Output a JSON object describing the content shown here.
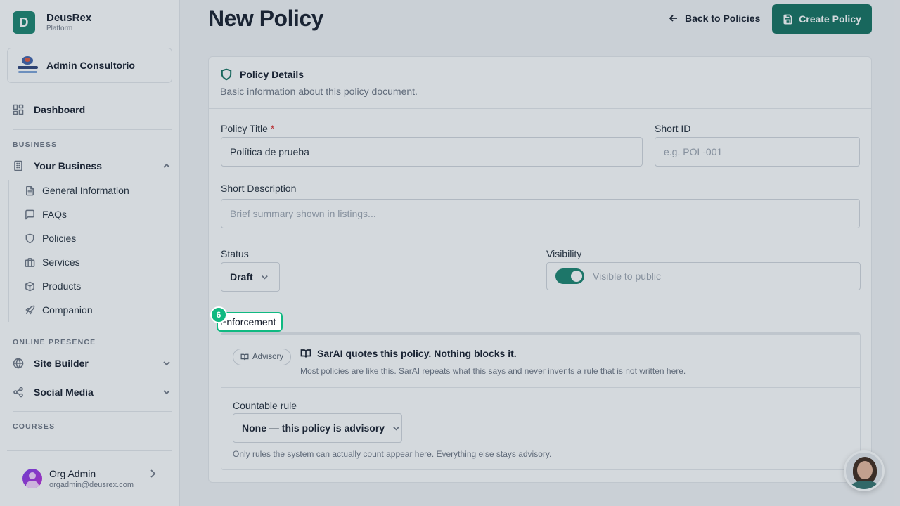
{
  "brand": {
    "logo_letter": "D",
    "name": "DeusRex",
    "subtitle": "Platform"
  },
  "org": {
    "name": "Admin Consultorio",
    "logo_icon": "org-logo"
  },
  "sidebar": {
    "dashboard": {
      "label": "Dashboard",
      "icon": "dashboard-grid-icon"
    },
    "business_label": "BUSINESS",
    "your_business": {
      "label": "Your Business",
      "icon": "building-icon",
      "expanded": true
    },
    "business_items": [
      {
        "label": "General Information",
        "icon": "file-text-icon"
      },
      {
        "label": "FAQs",
        "icon": "message-square-icon"
      },
      {
        "label": "Policies",
        "icon": "shield-icon"
      },
      {
        "label": "Services",
        "icon": "briefcase-icon"
      },
      {
        "label": "Products",
        "icon": "package-icon"
      },
      {
        "label": "Companion",
        "icon": "rocket-icon"
      }
    ],
    "online_presence_label": "ONLINE PRESENCE",
    "site_builder": {
      "label": "Site Builder",
      "icon": "globe-icon"
    },
    "social_media": {
      "label": "Social Media",
      "icon": "share-icon"
    },
    "courses_label": "COURSES",
    "user": {
      "name": "Org Admin",
      "email": "orgadmin@deusrex.com"
    }
  },
  "header": {
    "title": "New Policy",
    "back_label": "Back to Policies",
    "create_label": "Create Policy"
  },
  "policy_details": {
    "heading": "Policy Details",
    "description": "Basic information about this policy document.",
    "title_label": "Policy Title",
    "title_required": "*",
    "title_value": "Política de prueba",
    "short_id_label": "Short ID",
    "short_id_placeholder": "e.g. POL-001",
    "short_desc_label": "Short Description",
    "short_desc_placeholder": "Brief summary shown in listings...",
    "status_label": "Status",
    "status_value": "Draft",
    "visibility_label": "Visibility",
    "visibility_text": "Visible to public",
    "visibility_on": true
  },
  "enforcement": {
    "step_number": "6",
    "label": "Enforcement",
    "pill_label": "Advisory",
    "title": "SarAI quotes this policy. Nothing blocks it.",
    "description": "Most policies are like this. SarAI repeats what this says and never invents a rule that is not written here.",
    "rule_label": "Countable rule",
    "rule_value": "None — this policy is advisory",
    "rule_help": "Only rules the system can actually count appear here. Everything else stays advisory."
  },
  "colors": {
    "accent": "#0f6e5c",
    "highlight": "#10b981"
  }
}
